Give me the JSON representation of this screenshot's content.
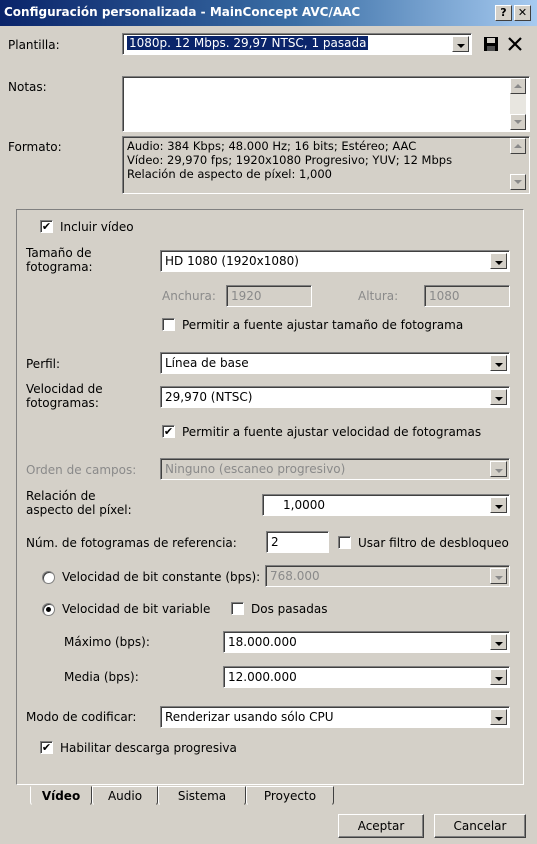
{
  "window": {
    "title": "Configuración personalizada - MainConcept AVC/AAC",
    "help": "?",
    "close": "✕"
  },
  "template": {
    "label": "Plantilla:",
    "value": "1080p. 12 Mbps. 29,97 NTSC, 1 pasada"
  },
  "notes": {
    "label": "Notas:",
    "value": ""
  },
  "format": {
    "label": "Formato:",
    "lines": [
      "Audio: 384 Kbps; 48.000 Hz; 16 bits; Estéreo; AAC",
      "Vídeo: 29,970 fps; 1920x1080 Progresivo; YUV; 12 Mbps",
      "Relación de aspecto de píxel: 1,000"
    ]
  },
  "video": {
    "include_video": {
      "label": "Incluir vídeo",
      "checked": true
    },
    "frame_size": {
      "label_line1": "Tamaño de",
      "label_line2": "fotograma:",
      "value": "HD 1080 (1920x1080)"
    },
    "width": {
      "label": "Anchura:",
      "value": "1920"
    },
    "height": {
      "label": "Altura:",
      "value": "1080"
    },
    "allow_source_size": {
      "label": "Permitir a fuente ajustar tamaño de fotograma",
      "checked": false
    },
    "profile": {
      "label": "Perfil:",
      "value": "Línea de base"
    },
    "frame_rate": {
      "label_line1": "Velocidad de",
      "label_line2": "fotogramas:",
      "value": "29,970 (NTSC)"
    },
    "allow_source_rate": {
      "label": "Permitir a fuente ajustar velocidad de fotogramas",
      "checked": true
    },
    "field_order": {
      "label": "Orden de campos:",
      "value": "Ninguno (escaneo progresivo)"
    },
    "pixel_aspect": {
      "label_line1": "Relación de",
      "label_line2": "aspecto del píxel:",
      "value": "1,0000"
    },
    "ref_frames": {
      "label": "Núm. de fotogramas de referencia:",
      "value": "2"
    },
    "deblocking": {
      "label": "Usar filtro de desbloqueo",
      "checked": false
    },
    "cbr": {
      "label": "Velocidad de bit constante (bps):",
      "value": "768.000",
      "selected": false
    },
    "vbr": {
      "label": "Velocidad de bit variable",
      "selected": true
    },
    "two_pass": {
      "label": "Dos pasadas",
      "checked": false
    },
    "max_bps": {
      "label": "Máximo (bps):",
      "value": "18.000.000"
    },
    "avg_bps": {
      "label": "Media (bps):",
      "value": "12.000.000"
    },
    "encode_mode": {
      "label": "Modo de codificar:",
      "value": "Renderizar usando sólo CPU"
    },
    "progressive_download": {
      "label": "Habilitar descarga progresiva",
      "checked": true
    }
  },
  "tabs": [
    "Vídeo",
    "Audio",
    "Sistema",
    "Proyecto"
  ],
  "buttons": {
    "ok": "Aceptar",
    "cancel": "Cancelar"
  },
  "colors": {
    "title_start": "#0a246a",
    "title_end": "#a6caf0",
    "dialog_bg": "#d4d0c8",
    "selection": "#0a246a"
  }
}
